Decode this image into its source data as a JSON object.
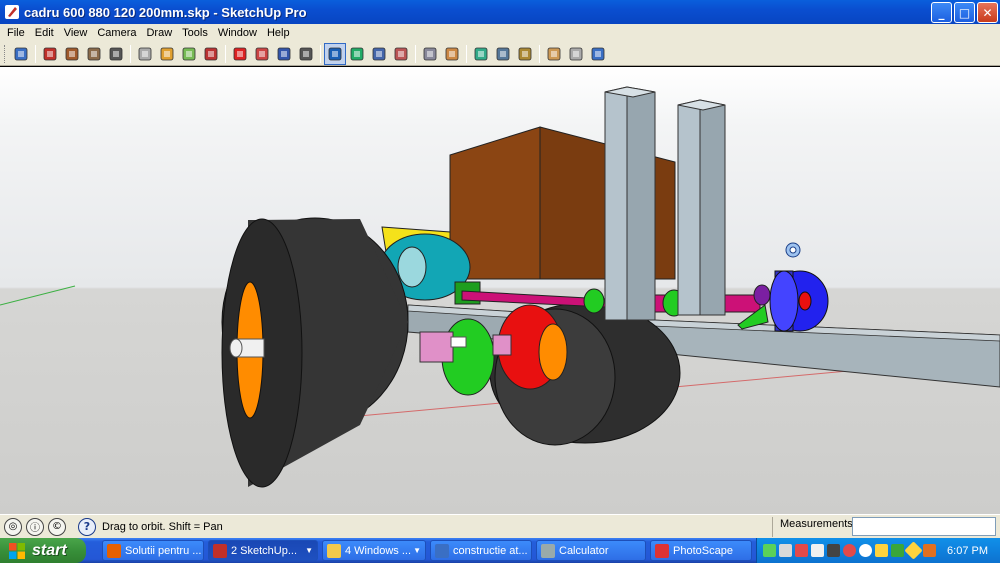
{
  "window": {
    "title": "cadru 600 880 120 200mm.skp - SketchUp Pro",
    "minimize": "_",
    "maximize": "□",
    "close": "✕"
  },
  "menu": [
    "File",
    "Edit",
    "View",
    "Camera",
    "Draw",
    "Tools",
    "Window",
    "Help"
  ],
  "toolbar": {
    "tools": [
      {
        "name": "select-tool-icon"
      },
      {
        "name": "sep"
      },
      {
        "name": "pencil-line-tool-icon"
      },
      {
        "name": "rectangle-tool-icon"
      },
      {
        "name": "circle-tool-icon"
      },
      {
        "name": "arc-tool-icon"
      },
      {
        "name": "sep"
      },
      {
        "name": "make-component-icon"
      },
      {
        "name": "eraser-tool-icon"
      },
      {
        "name": "tape-measure-icon"
      },
      {
        "name": "paint-bucket-icon"
      },
      {
        "name": "sep"
      },
      {
        "name": "push-pull-icon"
      },
      {
        "name": "move-tool-icon"
      },
      {
        "name": "rotate-tool-icon"
      },
      {
        "name": "follow-me-icon"
      },
      {
        "name": "sep"
      },
      {
        "name": "orbit-tool-icon",
        "active": true
      },
      {
        "name": "pan-tool-icon"
      },
      {
        "name": "zoom-tool-icon"
      },
      {
        "name": "zoom-extents-icon"
      },
      {
        "name": "sep"
      },
      {
        "name": "previous-view-icon"
      },
      {
        "name": "next-view-icon"
      },
      {
        "name": "sep"
      },
      {
        "name": "position-camera-icon"
      },
      {
        "name": "walk-tool-icon"
      },
      {
        "name": "look-around-icon"
      },
      {
        "name": "sep"
      },
      {
        "name": "get-models-icon"
      },
      {
        "name": "share-model-icon"
      },
      {
        "name": "share-component-icon"
      }
    ]
  },
  "status": {
    "hint": "Drag to orbit.  Shift = Pan",
    "measurements_label": "Measurements",
    "measurements_value": ""
  },
  "taskbar": {
    "start": "start",
    "tasks": [
      {
        "label": "Solutii pentru ...",
        "icon": "firefox-icon",
        "active": false
      },
      {
        "label": "2 SketchUp...",
        "icon": "sketchup-icon",
        "active": true,
        "group": true
      },
      {
        "label": "4 Windows ...",
        "icon": "folder-icon",
        "active": false,
        "group": true
      },
      {
        "label": "constructie at...",
        "icon": "document-icon",
        "active": false
      },
      {
        "label": "Calculator",
        "icon": "calculator-icon",
        "active": false
      },
      {
        "label": "PhotoScape",
        "icon": "photoscape-icon",
        "active": false
      }
    ],
    "clock": "6:07 PM"
  },
  "colors": {
    "titlebar": "#0a4ed0",
    "chrome": "#ece9d8",
    "tire": "#3a3a3a",
    "rim": "#ff8c00",
    "box": "#8b4513",
    "post": "#b5c3cc",
    "green": "#22cc22",
    "red": "#e81010",
    "teal": "#12a6b5",
    "magenta": "#cc1177",
    "blue": "#2222ee",
    "pink": "#e090c8"
  }
}
